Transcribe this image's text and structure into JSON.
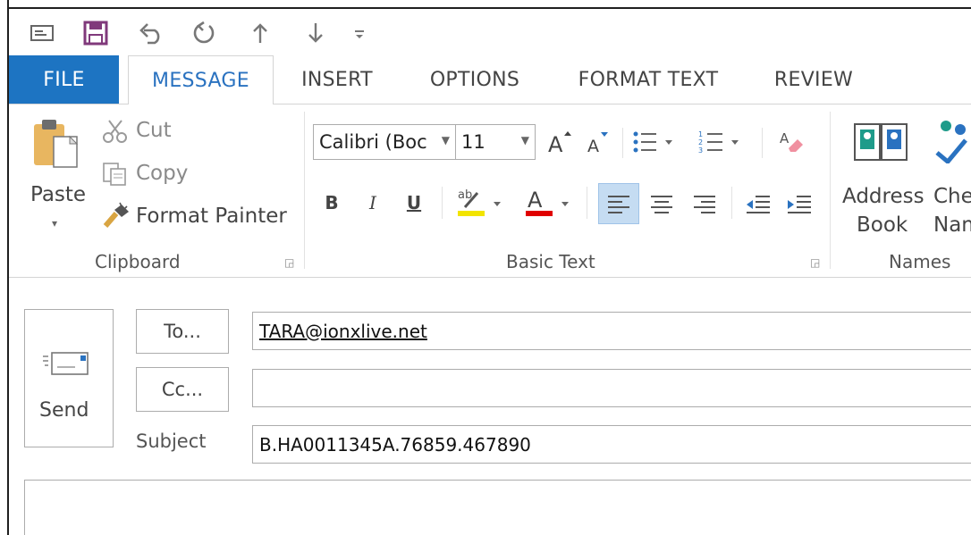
{
  "tabs": {
    "file": "FILE",
    "message": "MESSAGE",
    "insert": "INSERT",
    "options": "OPTIONS",
    "format_text": "FORMAT TEXT",
    "review": "REVIEW"
  },
  "clipboard": {
    "paste": "Paste",
    "cut": "Cut",
    "copy": "Copy",
    "format_painter": "Format Painter",
    "group": "Clipboard"
  },
  "basic_text": {
    "font_name": "Calibri (Boc",
    "font_size": "11",
    "bold": "B",
    "italic": "I",
    "underline": "U",
    "group": "Basic Text",
    "accent_highlight": "#f2e400",
    "accent_font_color": "#e00000"
  },
  "names": {
    "address_line1": "Address",
    "address_line2": "Book",
    "check_line1": "Che",
    "check_line2": "Nam",
    "group": "Names"
  },
  "compose": {
    "send": "Send",
    "to_button": "To...",
    "cc_button": "Cc...",
    "subject_label": "Subject",
    "to_value": "TARA@ionxlive.net",
    "cc_value": "",
    "subject_value": "B.HA0011345A.76859.467890"
  },
  "colors": {
    "file_tab": "#1d74c2",
    "active_tab_text": "#2a72c0",
    "save_icon": "#80397b"
  }
}
